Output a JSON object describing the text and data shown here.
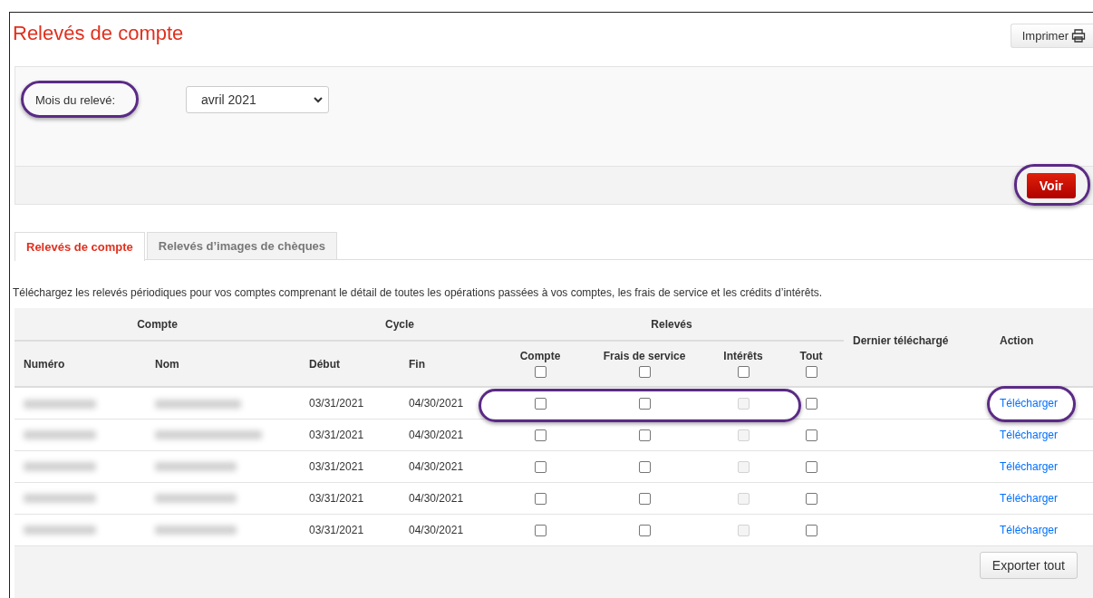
{
  "page": {
    "title": "Relevés de compte",
    "print_button": "Imprimer"
  },
  "filter": {
    "label": "Mois du relevé:",
    "label_highlighted": true,
    "month": "avril 2021",
    "submit": "Voir",
    "submit_highlighted": true
  },
  "tabs": [
    {
      "label": "Relevés de compte",
      "selected": true
    },
    {
      "label": "Relevés d’images de chèques",
      "selected": false
    }
  ],
  "description": "Téléchargez les relevés périodiques pour vos comptes comprenant le détail de toutes les opérations passées à vos comptes, les frais de service et les crédits d’intérêts.",
  "table": {
    "groups": {
      "account": "Compte",
      "cycle": "Cycle",
      "statements": "Relevés"
    },
    "columns": {
      "number": "Numéro",
      "name": "Nom",
      "start": "Début",
      "end": "Fin",
      "last": "Dernier téléchargé",
      "action": "Action"
    },
    "statement_columns": [
      {
        "label": "Compte",
        "checked": false,
        "disabled": false
      },
      {
        "label": "Frais de service",
        "checked": false,
        "disabled": false
      },
      {
        "label": "Intérêts",
        "checked": false,
        "disabled": false
      },
      {
        "label": "Tout",
        "checked": false,
        "disabled": false
      }
    ],
    "rows": [
      {
        "start": "03/31/2021",
        "end": "04/30/2021",
        "checks": [
          {
            "checked": false,
            "disabled": false
          },
          {
            "checked": false,
            "disabled": false
          },
          {
            "checked": false,
            "disabled": true
          },
          {
            "checked": false,
            "disabled": false
          }
        ],
        "checks_highlighted": true,
        "action": "Télécharger",
        "action_highlighted": true
      },
      {
        "start": "03/31/2021",
        "end": "04/30/2021",
        "checks": [
          {
            "checked": false,
            "disabled": false
          },
          {
            "checked": false,
            "disabled": false
          },
          {
            "checked": false,
            "disabled": true
          },
          {
            "checked": false,
            "disabled": false
          }
        ],
        "checks_highlighted": false,
        "action": "Télécharger",
        "action_highlighted": false
      },
      {
        "start": "03/31/2021",
        "end": "04/30/2021",
        "checks": [
          {
            "checked": false,
            "disabled": false
          },
          {
            "checked": false,
            "disabled": false
          },
          {
            "checked": false,
            "disabled": true
          },
          {
            "checked": false,
            "disabled": false
          }
        ],
        "checks_highlighted": false,
        "action": "Télécharger",
        "action_highlighted": false
      },
      {
        "start": "03/31/2021",
        "end": "04/30/2021",
        "checks": [
          {
            "checked": false,
            "disabled": false
          },
          {
            "checked": false,
            "disabled": false
          },
          {
            "checked": false,
            "disabled": true
          },
          {
            "checked": false,
            "disabled": false
          }
        ],
        "checks_highlighted": false,
        "action": "Télécharger",
        "action_highlighted": false
      },
      {
        "start": "03/31/2021",
        "end": "04/30/2021",
        "checks": [
          {
            "checked": false,
            "disabled": false
          },
          {
            "checked": false,
            "disabled": false
          },
          {
            "checked": false,
            "disabled": true
          },
          {
            "checked": false,
            "disabled": false
          }
        ],
        "checks_highlighted": false,
        "action": "Télécharger",
        "action_highlighted": false
      }
    ]
  },
  "export_button": "Exporter tout"
}
